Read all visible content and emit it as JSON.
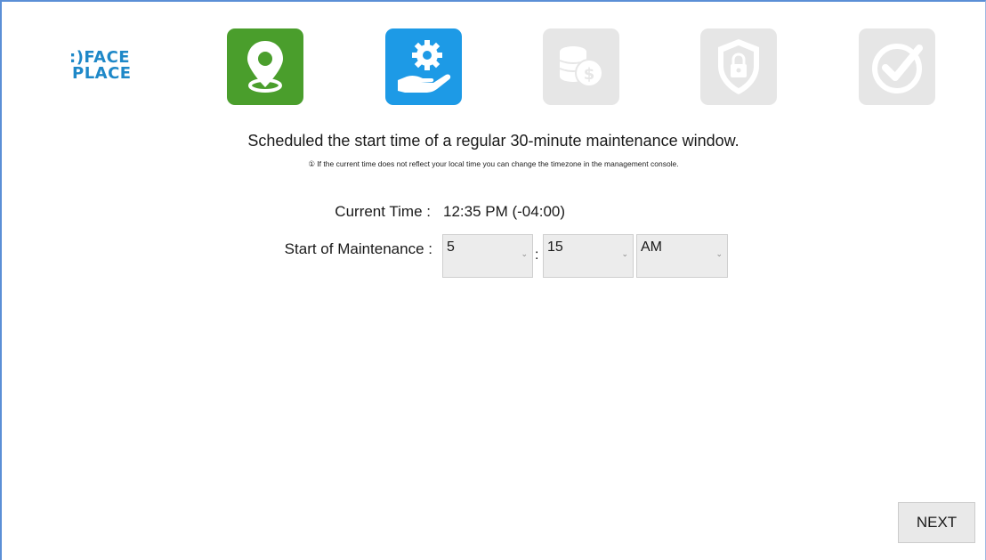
{
  "logo": {
    "line1": ":)FACE",
    "line2": "PLACE"
  },
  "steps": [
    {
      "icon": "location-pin-icon",
      "state": "completed",
      "color": "#4a9e2c"
    },
    {
      "icon": "gear-hand-icon",
      "state": "active",
      "color": "#1d9ae6"
    },
    {
      "icon": "coins-icon",
      "state": "pending",
      "color": "#e6e6e6"
    },
    {
      "icon": "shield-lock-icon",
      "state": "pending",
      "color": "#e6e6e6"
    },
    {
      "icon": "checkmark-icon",
      "state": "pending",
      "color": "#e6e6e6"
    }
  ],
  "main": {
    "heading": "Scheduled the start time of a regular 30-minute maintenance window.",
    "note": "① If the current time does not reflect your local time you can change the timezone in the management console.",
    "current_time_label": "Current Time :",
    "current_time_value": "12:35 PM (-04:00)",
    "maintenance_label": "Start of Maintenance :",
    "hour": "5",
    "minute": "15",
    "ampm": "AM",
    "separator": ":"
  },
  "footer": {
    "next_label": "NEXT"
  }
}
